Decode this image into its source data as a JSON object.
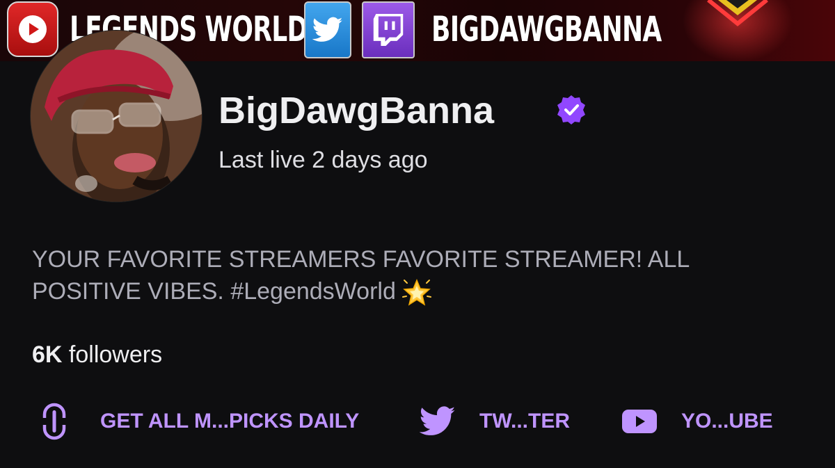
{
  "banner": {
    "left_text": "LEGENDS WORLD",
    "right_text": "BIGDAWGBANNA"
  },
  "profile": {
    "channel_name": "BigDawgBanna",
    "last_live": "Last live 2 days ago",
    "bio_text": "YOUR FAVORITE STREAMERS FAVORITE STREAMER! ALL POSITIVE VIBES. #LegendsWorld",
    "bio_emoji": "glowing-star",
    "followers_count": "6K",
    "followers_label": "followers"
  },
  "links": [
    {
      "label": "GET ALL M...PICKS DAILY",
      "icon": "link-icon"
    },
    {
      "label": "TW...TER",
      "icon": "twitter-icon"
    },
    {
      "label": "YO...UBE",
      "icon": "youtube-icon"
    }
  ],
  "colors": {
    "background": "#0e0e10",
    "accent": "#bf94ff",
    "verified_badge": "#9147ff",
    "text_primary": "#efeff1",
    "text_muted": "#adadb8"
  }
}
